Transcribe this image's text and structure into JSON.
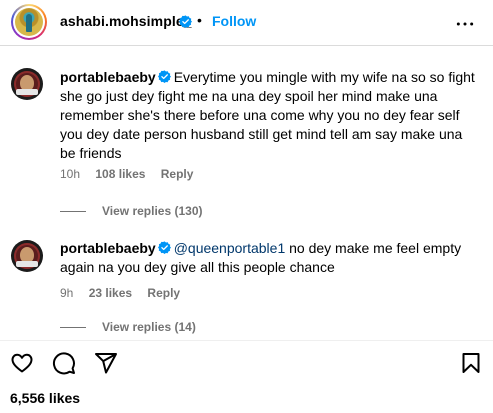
{
  "header": {
    "username": "ashabi.mohsimple_",
    "separator": "•",
    "follow_label": "Follow"
  },
  "comments": [
    {
      "username": "portablebaeby",
      "text": "Everytime you mingle with my wife na so so fight she go just dey fight me na una dey spoil her mind make una remember she's there before una come why you no dey fear self you dey date person husband still get mind tell am say make una be friends",
      "time": "10h",
      "likes": "108 likes",
      "reply_label": "Reply",
      "view_replies": "View replies (130)"
    },
    {
      "username": "portablebaeby",
      "mention": "@queenportable1",
      "text": " no dey make me feel empty again na you dey give all this people chance",
      "time": "9h",
      "likes": "23 likes",
      "reply_label": "Reply",
      "view_replies": "View replies (14)"
    }
  ],
  "post": {
    "likes": "6,556 likes"
  },
  "colors": {
    "accent": "#0095f6",
    "verified": "#0095f6",
    "muted": "#737373",
    "mention": "#00376b"
  },
  "icons": [
    "verified-icon",
    "more-icon",
    "heart-icon",
    "comment-icon",
    "share-icon",
    "bookmark-icon"
  ]
}
